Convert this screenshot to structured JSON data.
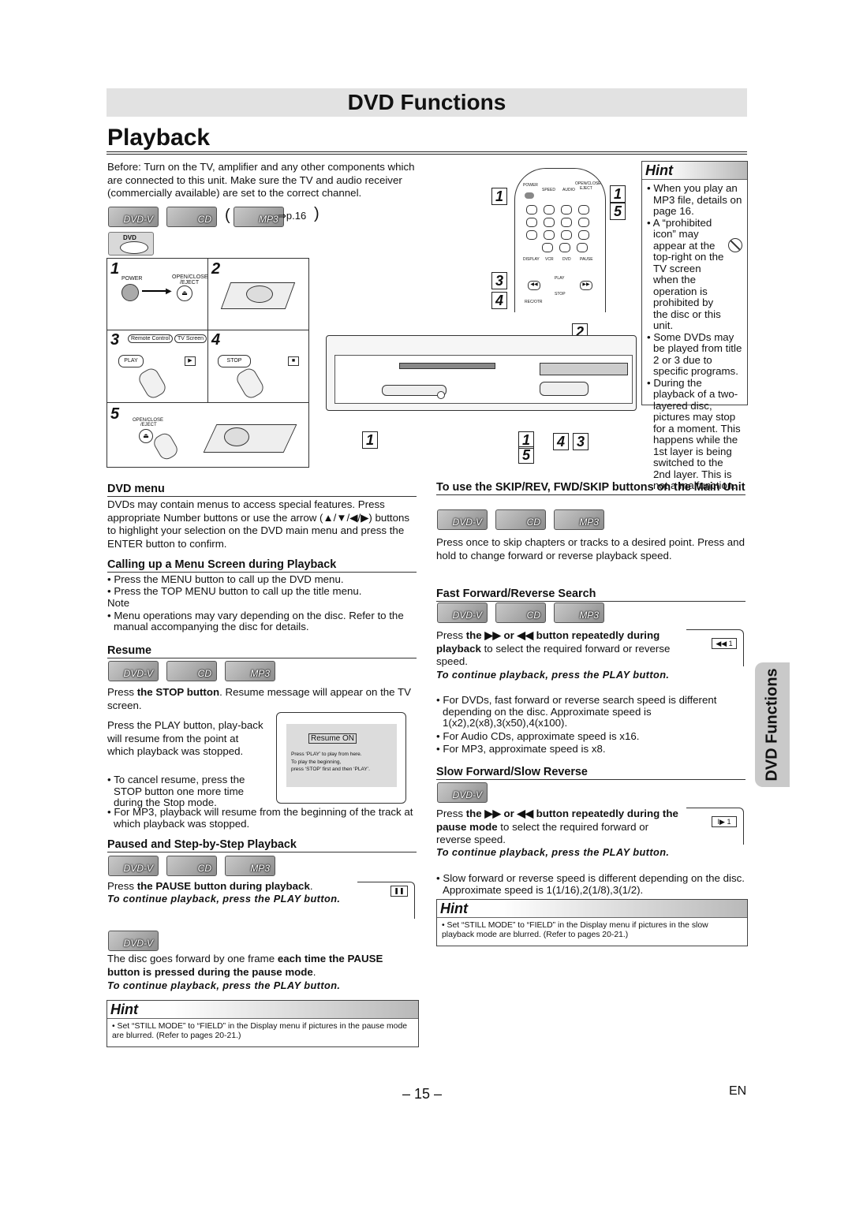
{
  "header": {
    "banner": "DVD Functions",
    "title": "Playback"
  },
  "intro": {
    "lines": [
      "Before: Turn on the TV, amplifier and any other components which",
      "are connected to this unit. Make sure the TV and audio receiver",
      "(commercially available) are set to the correct channel."
    ],
    "page_ref": "⇒p.16"
  },
  "badges": {
    "dvd": "DVD-V",
    "cd": "CD",
    "mp3": "MP3"
  },
  "steps": {
    "s1": "1",
    "s2": "2",
    "s3": "3",
    "s4": "4",
    "s5": "5",
    "power_label": "POWER",
    "open_close_label": "OPEN/CLOSE",
    "eject_label": "/EJECT",
    "remote_control": "Remote Control",
    "tv_screen": "TV Screen",
    "play_label": "PLAY",
    "stop_label": "STOP",
    "dvd_logo": "DVD"
  },
  "remote": {
    "labels": [
      "POWER",
      "SPEED",
      "AUDIO",
      "OPEN/CLOSE",
      "EJECT",
      "DISPLAY",
      "VCR",
      "DVD",
      "PAUSE",
      "REC/OTR",
      "PLAY",
      "STOP"
    ],
    "callouts": {
      "c1a": "1",
      "c1b": "1",
      "c5": "5",
      "c3": "3",
      "c4": "4",
      "c2": "2"
    }
  },
  "unit_callouts": {
    "b1": "1",
    "b1b": "1",
    "b4": "4",
    "b3": "3",
    "b5": "5"
  },
  "hint_top": {
    "title": "Hint",
    "items": [
      "When you play an MP3 file, details on page 16.",
      "A “prohibited icon” may appear at the top-right on the TV screen when the operation is prohibited by the disc or this unit.",
      "Some DVDs may be played from title 2 or 3 due to specific programs.",
      "During the playback of a two-layered disc, pictures may stop for a moment. This happens while the 1st layer is being switched to the 2nd layer. This is not a malfunction."
    ]
  },
  "dvd_menu": {
    "heading": "DVD menu",
    "body": "DVDs may contain menus to access special features. Press appropriate Number buttons or use the arrow (▲/▼/◀/▶) buttons to highlight your selection on the DVD main menu and press the ENTER button to confirm."
  },
  "calling_menu": {
    "heading": "Calling up a Menu Screen during Playback",
    "b1": "Press the MENU button to call up the DVD menu.",
    "b2": "Press the TOP MENU button to call up the title menu.",
    "note_label": "Note",
    "b3": "Menu operations may vary depending on the disc. Refer to the manual accompanying the disc for details."
  },
  "resume": {
    "heading": "Resume",
    "p1_pre": "Press ",
    "p1_bold": "the STOP button",
    "p1_post": ". Resume message will appear on the TV screen.",
    "p2": "Press the PLAY button, play-back will resume from the point at which playback was stopped.",
    "b1": "To cancel resume, press the STOP button one more time during the Stop mode.",
    "b2": "For MP3, playback will resume from the beginning  of the track at which playback was stopped.",
    "screen_title": "Resume ON",
    "screen_lines": [
      "Press ‘PLAY’ to play from here.",
      "To play the beginning,",
      "press ‘STOP’ first and then ‘PLAY’."
    ]
  },
  "pause": {
    "heading": "Paused and Step-by-Step Playback",
    "p1_pre": "Press ",
    "p1_bold": "the PAUSE button during playback",
    "p1_post": ".",
    "note1": "To continue playback, press the PLAY button.",
    "p2_pre": "The disc goes forward by one frame ",
    "p2_bold": "each time the PAUSE button is pressed during the pause mode",
    "p2_post": ".",
    "note2": "To continue playback, press the PLAY button."
  },
  "hint_bottom_left": {
    "title": "Hint",
    "text": "Set “STILL MODE” to “FIELD” in the Display menu if pictures in the pause mode are blurred. (Refer to pages 20-21.)"
  },
  "skip": {
    "heading": "To use the SKIP/REV, FWD/SKIP buttons on the Main Unit",
    "body": "Press once to skip chapters or tracks to a desired point. Press and hold to change forward or reverse playback speed."
  },
  "ff": {
    "heading": "Fast Forward/Reverse Search",
    "p1_a": "Press ",
    "p1_b": "the ▶▶ or ◀◀ button repeatedly during playback",
    "p1_c": " to select the required forward or reverse speed.",
    "osd": "◀◀ 1",
    "note": "To continue playback, press the PLAY button.",
    "b1": "For DVDs, fast forward or reverse search speed is different depending on the disc. Approximate speed is 1(x2),2(x8),3(x50),4(x100).",
    "b2": "For Audio CDs, approximate speed is x16.",
    "b3": "For MP3, approximate speed is x8."
  },
  "slow": {
    "heading": "Slow Forward/Slow Reverse",
    "p1_a": "Press ",
    "p1_b": "the ▶▶ or ◀◀ button repeatedly during the pause mode",
    "p1_c": " to select the required forward or reverse speed.",
    "osd": "I▶ 1",
    "note": "To continue playback, press the PLAY button.",
    "b1": "Slow forward or reverse speed is different depending on the disc. Approximate speed is 1(1/16),2(1/8),3(1/2)."
  },
  "hint_bottom_right": {
    "title": "Hint",
    "text": "Set “STILL MODE”  to “FIELD” in the Display menu if pictures in the slow playback mode are blurred. (Refer to pages 20-21.)"
  },
  "side_tab": "DVD Functions",
  "footer": {
    "page": "– 15 –",
    "lang": "EN"
  }
}
